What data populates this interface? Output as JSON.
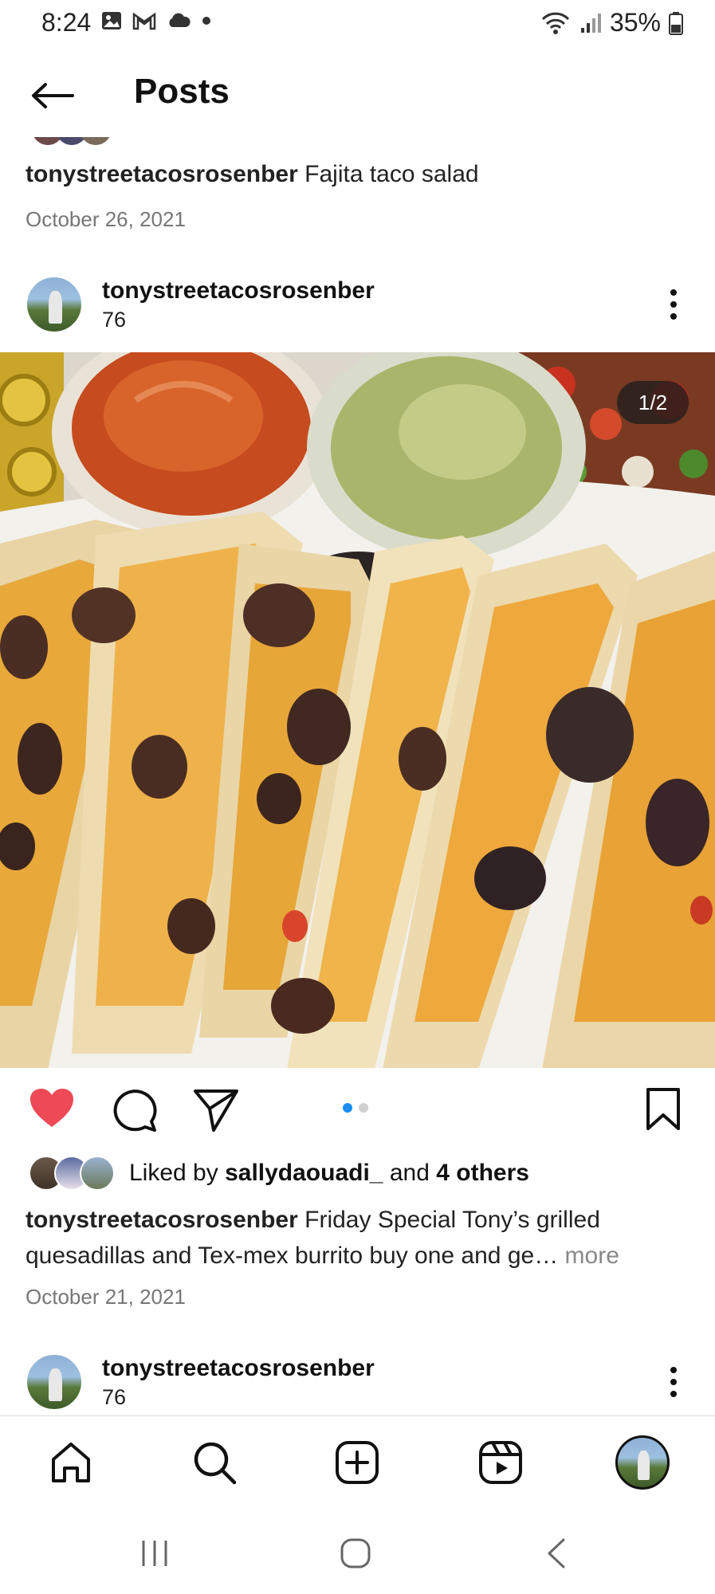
{
  "status_bar": {
    "time": "8:24",
    "battery": "35%",
    "icons": [
      "image-icon",
      "gmail-icon",
      "cloud-icon",
      "dot-icon",
      "wifi-icon",
      "signal-icon",
      "battery-icon"
    ]
  },
  "header": {
    "title": "Posts",
    "back_icon": "arrow-left-icon"
  },
  "previous_post": {
    "username": "tonystreetacosrosenber",
    "caption": "Fajita taco salad",
    "date": "October 26, 2021"
  },
  "post": {
    "username": "tonystreetacosrosenber",
    "subtitle": "76",
    "image_counter": "1/2",
    "carousel": {
      "count": 2,
      "active": 0
    },
    "liked": true,
    "likes": {
      "prefix": "Liked by ",
      "user": "sallydaouadi_",
      "middle": " and ",
      "others": "4 others"
    },
    "caption_username": "tonystreetacosrosenber",
    "caption_text": "Friday Special Tony’s grilled quesadillas and Tex-mex burrito buy one and ge…",
    "more_label": "more",
    "date": "October 21, 2021"
  },
  "next_post": {
    "username": "tonystreetacosrosenber",
    "subtitle": "76"
  },
  "bottom_nav": {
    "items": [
      "home-icon",
      "search-icon",
      "create-icon",
      "reels-icon",
      "profile-avatar"
    ]
  },
  "system_nav": {
    "items": [
      "recents-icon",
      "home-circle-icon",
      "back-chevron-icon"
    ]
  },
  "colors": {
    "like_red": "#ed4956",
    "dot_active": "#1a8ef2",
    "text": "#111111",
    "muted": "#777777"
  }
}
